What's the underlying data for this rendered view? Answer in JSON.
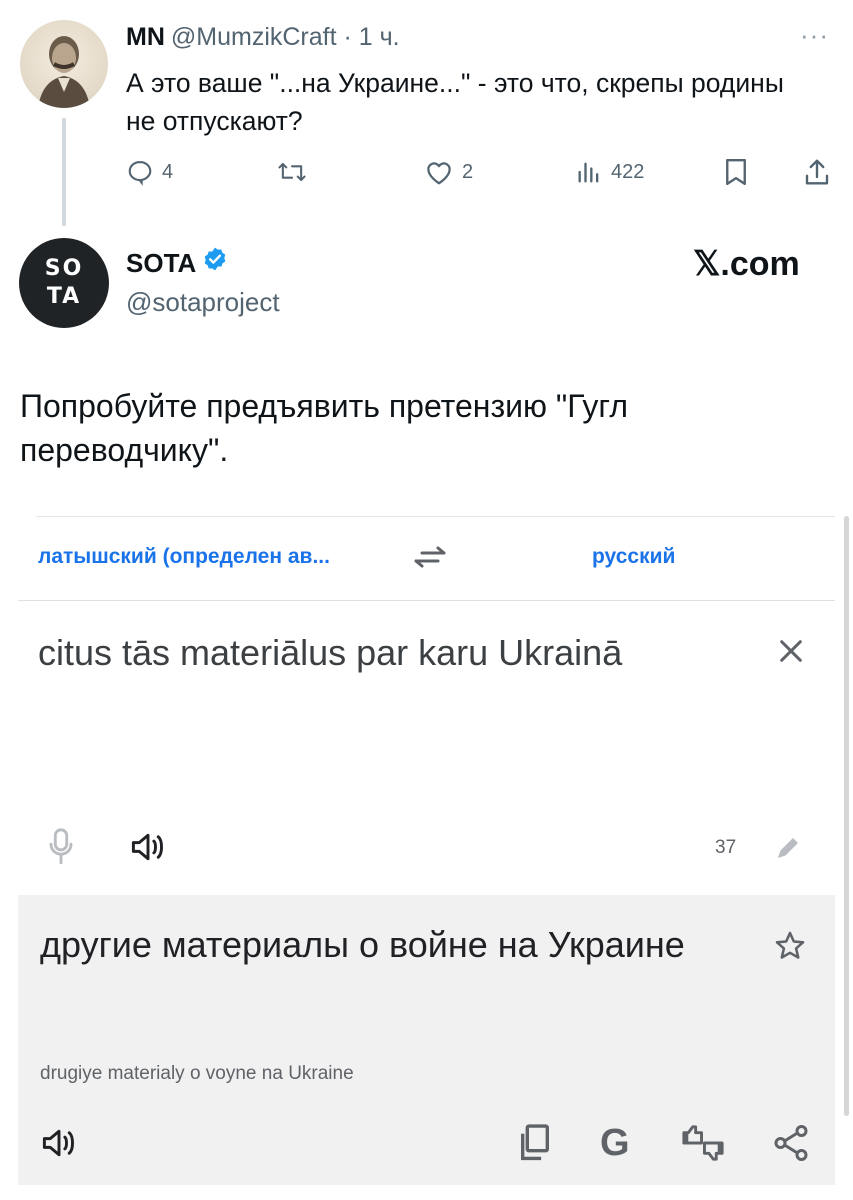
{
  "reply": {
    "name": "MN",
    "handle": "@MumzikCraft",
    "separator": "·",
    "time": "1 ч.",
    "more": "···",
    "text": "А это ваше \"...на Украине...\" - это что, скрепы родины не отпускают?",
    "actions": {
      "replies": "4",
      "retweets": "",
      "likes": "2",
      "views": "422"
    }
  },
  "post": {
    "name": "SOTA",
    "verified": true,
    "handle": "@sotaproject",
    "avatar_line1": "SO",
    "avatar_line2": "TA",
    "watermark": "𝕏.com",
    "text": "Попробуйте предъявить претензию \"Гугл переводчику\"."
  },
  "translate": {
    "source_lang": "латышский (определен ав...",
    "target_lang": "русский",
    "source_text": "citus tās materiālus par karu Ukrainā",
    "char_count": "37",
    "translation": "другие материалы о войне на Украине",
    "transliteration": "drugiye materialy o voyne na Ukraine",
    "accent_color": "#1a73e8"
  },
  "colors": {
    "text": "#0f1419",
    "secondary": "#536471",
    "verified": "#1d9bf0",
    "result_bg": "#f1f1f1"
  }
}
